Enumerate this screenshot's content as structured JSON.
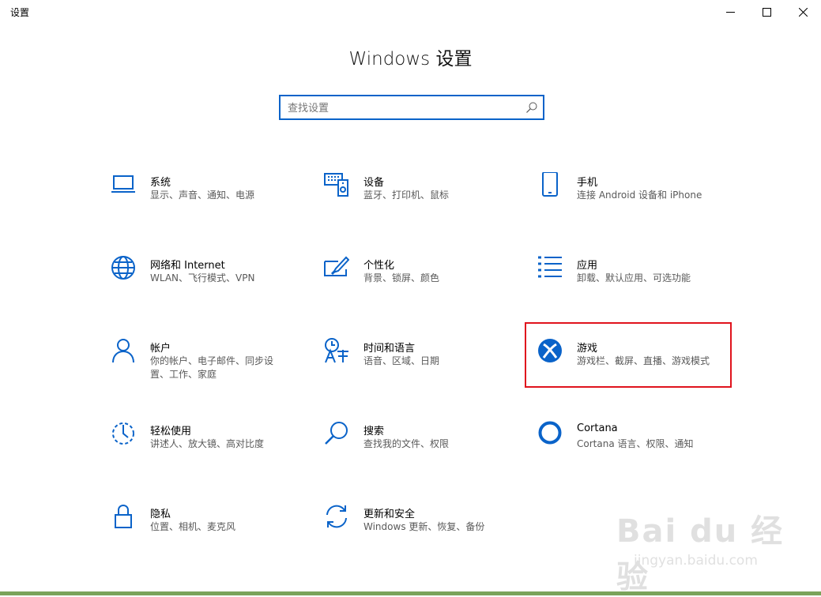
{
  "window": {
    "title": "设置"
  },
  "header": {
    "title": "Windows 设置"
  },
  "search": {
    "placeholder": "查找设置"
  },
  "accent_color": "#0a63c9",
  "highlight_color": "#e0131d",
  "tiles": [
    {
      "label": "系统",
      "desc": "显示、声音、通知、电源",
      "icon": "laptop-icon"
    },
    {
      "label": "设备",
      "desc": "蓝牙、打印机、鼠标",
      "icon": "devices-icon"
    },
    {
      "label": "手机",
      "desc": "连接 Android 设备和 iPhone",
      "icon": "phone-icon"
    },
    {
      "label": "网络和 Internet",
      "desc": "WLAN、飞行模式、VPN",
      "icon": "globe-icon"
    },
    {
      "label": "个性化",
      "desc": "背景、锁屏、颜色",
      "icon": "personalization-icon"
    },
    {
      "label": "应用",
      "desc": "卸载、默认应用、可选功能",
      "icon": "apps-list-icon"
    },
    {
      "label": "帐户",
      "desc": "你的帐户、电子邮件、同步设置、工作、家庭",
      "icon": "person-icon"
    },
    {
      "label": "时间和语言",
      "desc": "语音、区域、日期",
      "icon": "time-language-icon"
    },
    {
      "label": "游戏",
      "desc": "游戏栏、截屏、直播、游戏模式",
      "icon": "xbox-icon"
    },
    {
      "label": "轻松使用",
      "desc": "讲述人、放大镜、高对比度",
      "icon": "ease-of-access-icon"
    },
    {
      "label": "搜索",
      "desc": "查找我的文件、权限",
      "icon": "magnifier-icon"
    },
    {
      "label": "Cortana",
      "desc": "Cortana 语言、权限、通知",
      "icon": "cortana-icon"
    },
    {
      "label": "隐私",
      "desc": "位置、相机、麦克风",
      "icon": "lock-icon"
    },
    {
      "label": "更新和安全",
      "desc": "Windows 更新、恢复、备份",
      "icon": "sync-icon"
    }
  ],
  "watermark": {
    "brand": "Bai du 经验",
    "url": "jingyan.baidu.com"
  }
}
